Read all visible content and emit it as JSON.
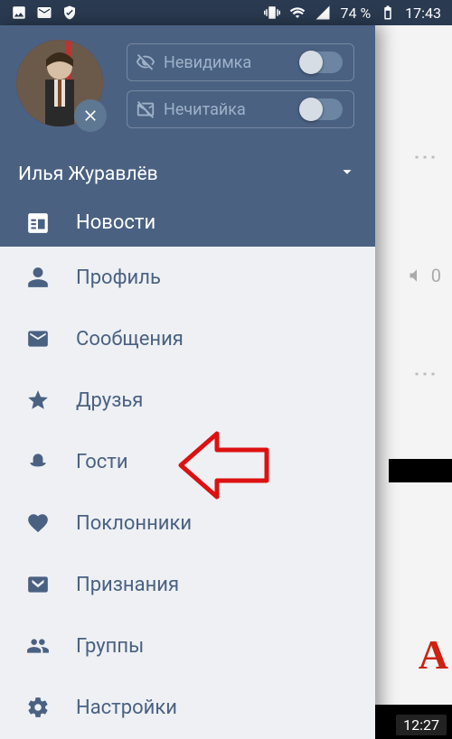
{
  "statusbar": {
    "battery_pct": "74 %",
    "time": "17:43"
  },
  "header": {
    "toggles": [
      {
        "label": "Невидимка"
      },
      {
        "label": "Нечитайка"
      }
    ],
    "user_name": "Илья Журавлёв"
  },
  "nav": {
    "top_item": "Новости",
    "items": [
      "Профиль",
      "Сообщения",
      "Друзья",
      "Гости",
      "Поклонники",
      "Признания",
      "Группы",
      "Настройки"
    ]
  },
  "bg": {
    "mute_count": "0",
    "letter": "А",
    "video_time": "12:27"
  }
}
